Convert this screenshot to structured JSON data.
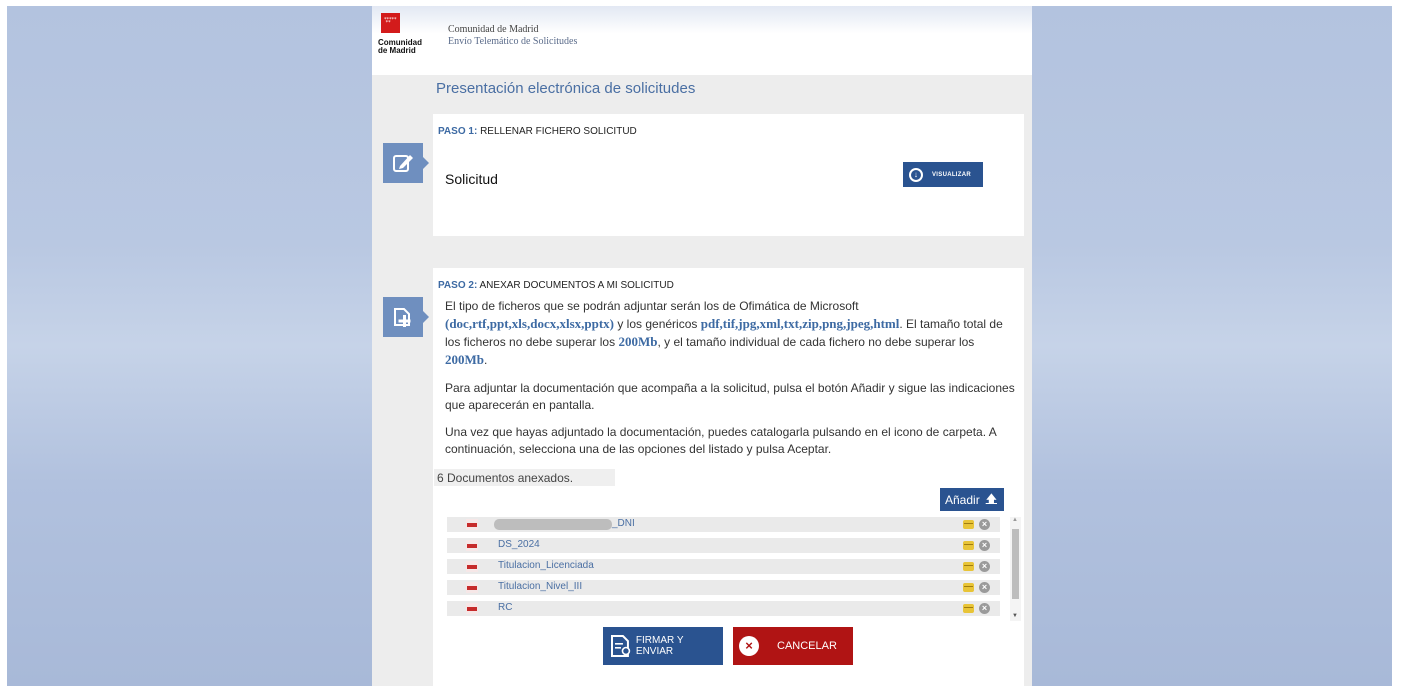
{
  "header": {
    "logo_text": "Comunidad de Madrid",
    "org_name": "Comunidad de Madrid",
    "org_subtitle": "Envío Telemático de Solicitudes"
  },
  "page_title": "Presentación electrónica de solicitudes",
  "step1": {
    "step_number": "PASO 1:",
    "title": "RELLENAR FICHERO SOLICITUD",
    "document_label": "Solicitud",
    "view_button": "VISUALIZAR"
  },
  "step2": {
    "step_number": "PASO 2:",
    "title": "ANEXAR DOCUMENTOS A MI SOLICITUD",
    "para1": {
      "t1": "El tipo de ficheros que se podrán adjuntar serán los de Ofimática de Microsoft ",
      "ext_office": "(doc,rtf,ppt,xls,docx,xlsx,pptx)",
      "t2": " y los genéricos ",
      "ext_generic": "pdf,tif,jpg,xml,txt,zip,png,jpeg,html",
      "t3": ". El tamaño total de los ficheros no debe superar los ",
      "size_total": "200Mb",
      "t4": ", y el tamaño individual de cada fichero no debe superar los ",
      "size_individual": "200Mb",
      "t5": "."
    },
    "para2": "Para adjuntar la documentación que acompaña a la solicitud, pulsa el botón Añadir y sigue las indicaciones que aparecerán en pantalla.",
    "para3": "Una vez que hayas adjuntado la documentación, puedes catalogarla pulsando en el icono de carpeta. A continuación, selecciona una de las opciones del listado y pulsa Aceptar.",
    "documents_count": "6 Documentos anexados.",
    "add_button": "Añadir",
    "add_icon": "upload-arrow-icon",
    "documents": [
      {
        "name": "_DNI",
        "redacted": true
      },
      {
        "name": "DS_2024",
        "redacted": false
      },
      {
        "name": "Titulacion_Licenciada",
        "redacted": false
      },
      {
        "name": "Titulacion_Nivel_III",
        "redacted": false
      },
      {
        "name": "RC",
        "redacted": false
      }
    ]
  },
  "actions": {
    "sign_button": "FIRMAR Y ENVIAR",
    "cancel_button": "CANCELAR"
  },
  "colors": {
    "primary": "#2a5390",
    "accent_text": "#3d6aa3",
    "cancel": "#b01414",
    "logo_red": "#d31b1b",
    "side_icon": "#6f8fbf"
  }
}
